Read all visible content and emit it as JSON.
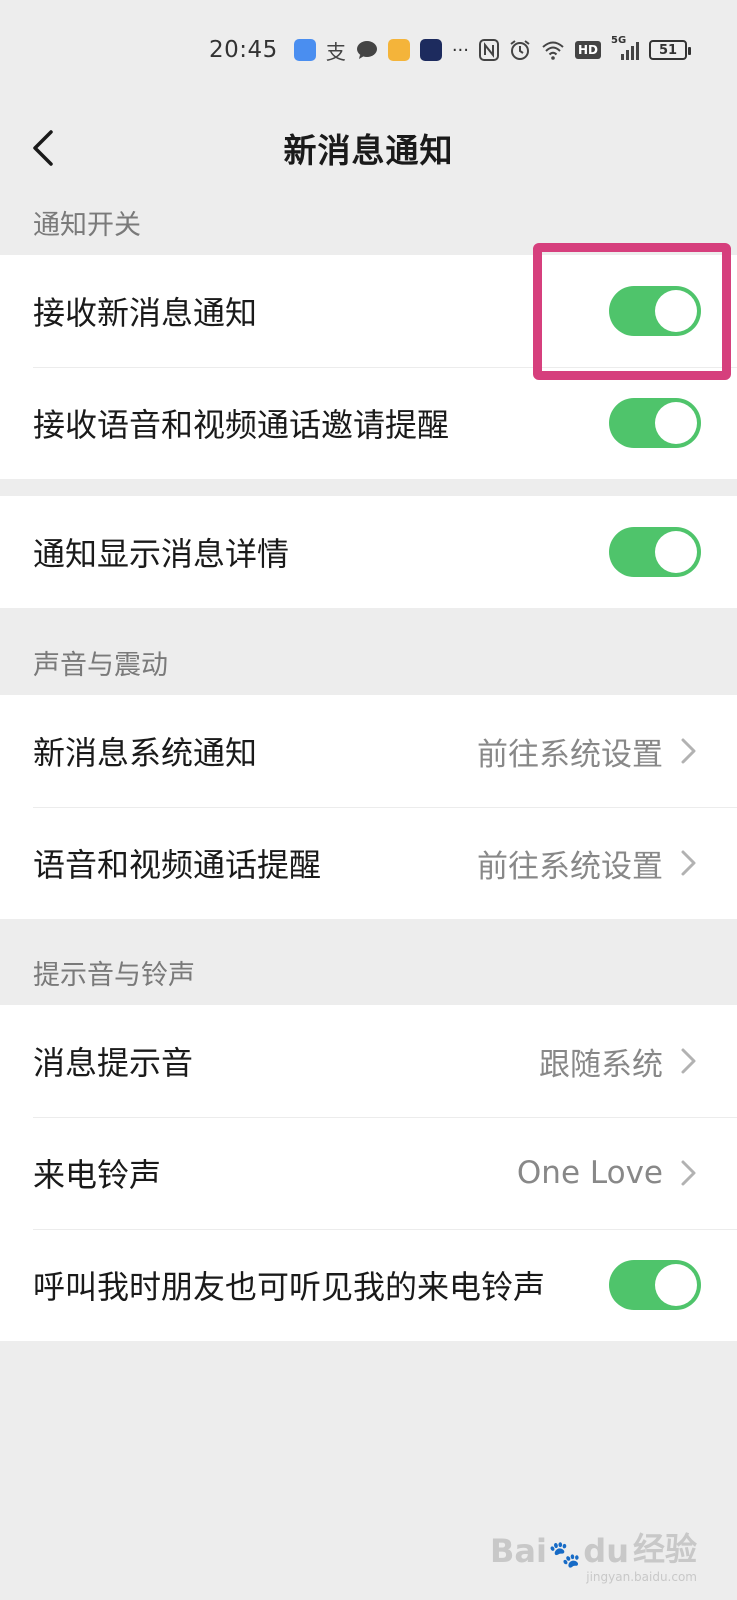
{
  "status_bar": {
    "time": "20:45",
    "more": "···",
    "network_label": "5G",
    "hd_label": "HD",
    "battery": "51",
    "icons": [
      "app-shield-icon",
      "alipay-icon",
      "message-bubble-icon",
      "app-square-icon",
      "app-robot-icon",
      "nfc-icon",
      "alarm-icon",
      "wifi-icon",
      "hd-icon",
      "signal-icon",
      "battery-icon"
    ]
  },
  "header": {
    "title": "新消息通知",
    "back_icon": "chevron-left-icon"
  },
  "sections": {
    "notifications_label": "通知开关",
    "sound_label": "声音与震动",
    "ringtone_label": "提示音与铃声"
  },
  "rows": {
    "receive_new": {
      "label": "接收新消息通知",
      "toggle_on": true
    },
    "receive_call": {
      "label": "接收语音和视频通话邀请提醒",
      "toggle_on": true
    },
    "show_details": {
      "label": "通知显示消息详情",
      "toggle_on": true
    },
    "system_notify": {
      "label": "新消息系统通知",
      "value": "前往系统设置"
    },
    "call_remind": {
      "label": "语音和视频通话提醒",
      "value": "前往系统设置"
    },
    "msg_sound": {
      "label": "消息提示音",
      "value": "跟随系统"
    },
    "ringtone": {
      "label": "来电铃声",
      "value": "One Love"
    },
    "friends_hear": {
      "label": "呼叫我时朋友也可听见我的来电铃声",
      "toggle_on": true
    }
  },
  "colors": {
    "toggle_on": "#4fc46b",
    "highlight": "#d63f7d",
    "background": "#ededed"
  },
  "watermark": {
    "brand": "Bai",
    "brand2": "du",
    "suffix": "经验",
    "url": "jingyan.baidu.com"
  }
}
